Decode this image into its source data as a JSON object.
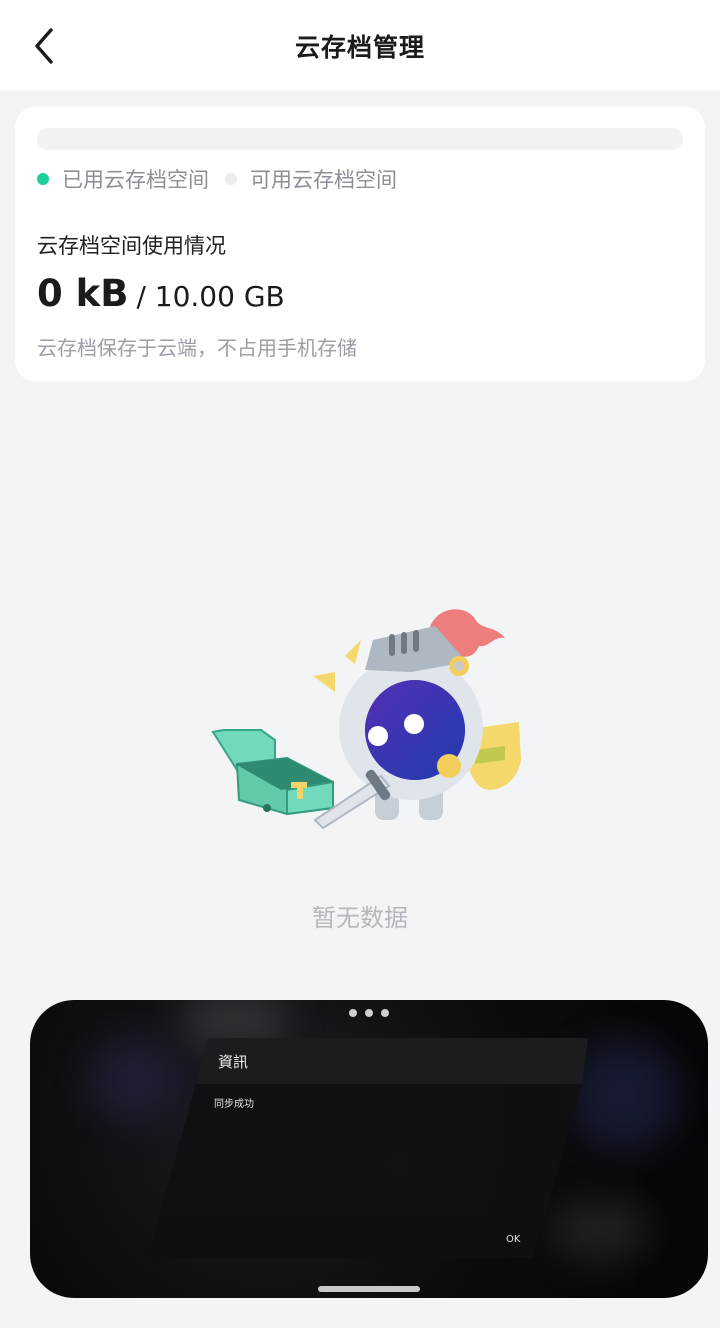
{
  "header": {
    "title": "云存档管理"
  },
  "storage": {
    "used_fraction": 0,
    "legend_used": "已用云存档空间",
    "legend_available": "可用云存档空间",
    "section_label": "云存档空间使用情况",
    "used": "0 kB",
    "total": "/ 10.00 GB",
    "hint": "云存档保存于云端，不占用手机存储"
  },
  "empty_state": {
    "text": "暂无数据"
  },
  "overlay": {
    "dialog_title": "資訊",
    "dialog_message": "同步成功",
    "ok_label": "OK"
  },
  "colors": {
    "accent": "#1ccf9b",
    "available": "#ebecef",
    "page_bg": "#f3f4f6",
    "card_bg": "#ffffff"
  }
}
